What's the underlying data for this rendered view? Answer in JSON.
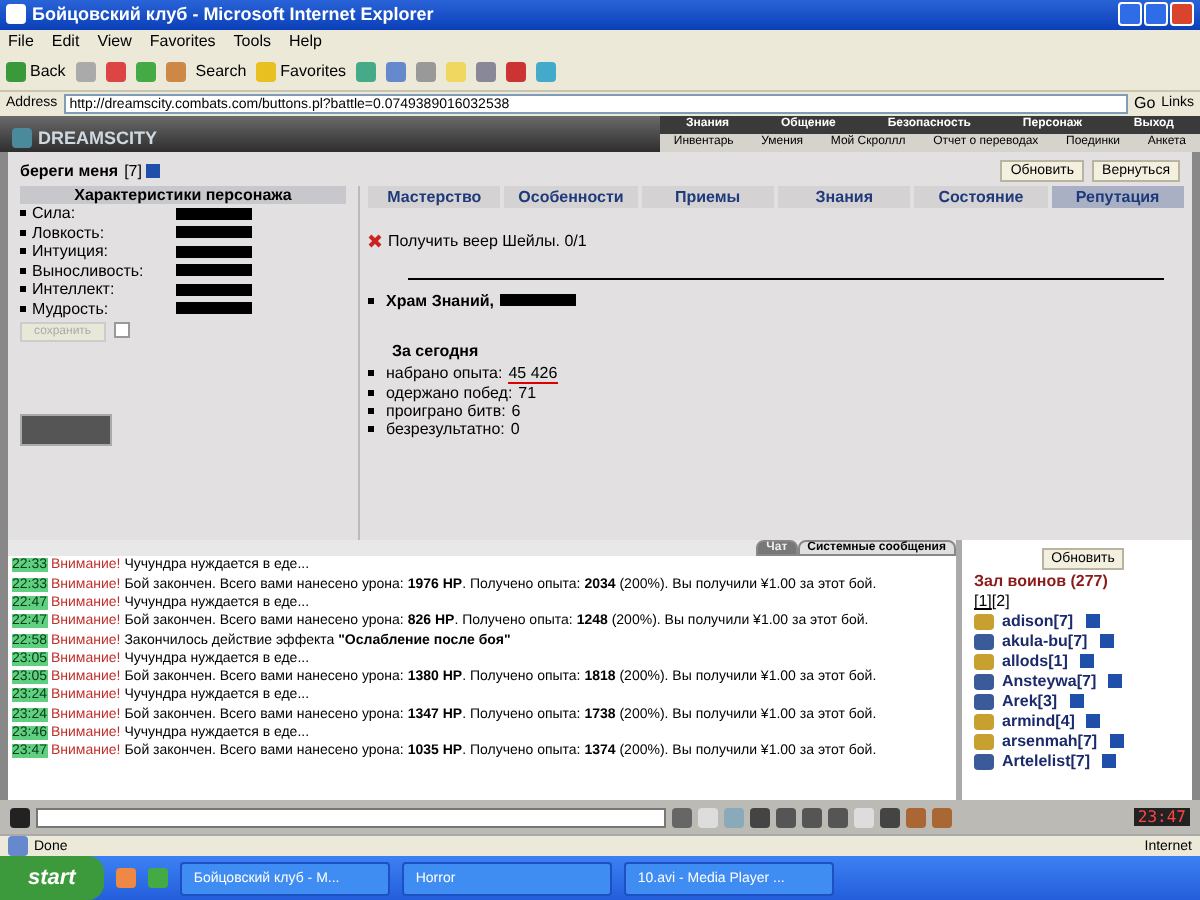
{
  "window": {
    "title": "Бойцовский клуб - Microsoft Internet Explorer"
  },
  "menu": [
    "File",
    "Edit",
    "View",
    "Favorites",
    "Tools",
    "Help"
  ],
  "toolbar": {
    "back": "Back",
    "search": "Search",
    "favorites": "Favorites"
  },
  "address": {
    "label": "Address",
    "url": "http://dreamscity.combats.com/buttons.pl?battle=0.0749389016032538",
    "go": "Go",
    "links": "Links"
  },
  "game_header": {
    "logo": "DREAMSCITY",
    "nav": [
      "Знания",
      "Общение",
      "Безопасность",
      "Персонаж",
      "Выход"
    ],
    "subnav": [
      "Инвентарь",
      "Умения",
      "Мой Скроллл",
      "Отчет о переводах",
      "Поединки",
      "Анкета"
    ]
  },
  "character": {
    "name": "береги меня",
    "level": "[7]",
    "buttons": [
      "Обновить",
      "Вернуться"
    ]
  },
  "stats": {
    "title": "Характеристики персонажа",
    "items": [
      "Сила:",
      "Ловкость:",
      "Интуиция:",
      "Выносливость:",
      "Интеллект:",
      "Мудрость:"
    ],
    "save": {
      "label": "сохранить",
      "disabled": true
    },
    "checkbox": {
      "checked": false
    }
  },
  "tabs": [
    {
      "label": "Мастерство",
      "selected": false
    },
    {
      "label": "Особенности",
      "selected": false
    },
    {
      "label": "Приемы",
      "selected": false
    },
    {
      "label": "Знания",
      "selected": false
    },
    {
      "label": "Состояние",
      "selected": false
    },
    {
      "label": "Репутация",
      "selected": true
    }
  ],
  "reputation": {
    "quest": "Получить веер Шейлы. 0/1",
    "place": "Храм Знаний,",
    "today_title": "За сегодня",
    "today": [
      {
        "label": "набрано опыта:",
        "value": "45 426",
        "highlighted": true
      },
      {
        "label": "одержано побед:",
        "value": "71",
        "highlighted": false
      },
      {
        "label": "проиграно битв:",
        "value": "6",
        "highlighted": false
      },
      {
        "label": "безрезультатно:",
        "value": "0",
        "highlighted": false
      }
    ]
  },
  "chat": {
    "tabs": [
      {
        "label": "Чат",
        "selected": false
      },
      {
        "label": "Системные сообщения",
        "selected": true
      }
    ],
    "messages": [
      {
        "time": "22:33",
        "alert": "Внимание!",
        "text": "Чучундра нуждается в еде..."
      },
      {
        "time": "22:33",
        "alert": "Внимание!",
        "text": "Бой закончен. Всего вами нанесено урона: **1976 HP**. Получено опыта: **2034** (200%). Вы получили ¥1.00 за этот бой."
      },
      {
        "time": "22:47",
        "alert": "Внимание!",
        "text": "Чучундра нуждается в еде..."
      },
      {
        "time": "22:47",
        "alert": "Внимание!",
        "text": "Бой закончен. Всего вами нанесено урона: **826 HP**. Получено опыта: **1248** (200%). Вы получили ¥1.00 за этот бой."
      },
      {
        "time": "22:58",
        "alert": "Внимание!",
        "text": "Закончилось действие эффекта **\"Ослабление после боя\"**"
      },
      {
        "time": "23:05",
        "alert": "Внимание!",
        "text": "Чучундра нуждается в еде..."
      },
      {
        "time": "23:05",
        "alert": "Внимание!",
        "text": "Бой закончен. Всего вами нанесено урона: **1380 HP**. Получено опыта: **1818** (200%). Вы получили ¥1.00 за этот бой."
      },
      {
        "time": "23:24",
        "alert": "Внимание!",
        "text": "Чучундра нуждается в еде..."
      },
      {
        "time": "23:24",
        "alert": "Внимание!",
        "text": "Бой закончен. Всего вами нанесено урона: **1347 HP**. Получено опыта: **1738** (200%). Вы получили ¥1.00 за этот бой."
      },
      {
        "time": "23:46",
        "alert": "Внимание!",
        "text": "Чучундра нуждается в еде..."
      },
      {
        "time": "23:47",
        "alert": "Внимание!",
        "text": "Бой закончен. Всего вами нанесено урона: **1035 HP**. Получено опыта: **1374** (200%). Вы получили ¥1.00 за этот бой."
      }
    ]
  },
  "room": {
    "refresh": "Обновить",
    "title": "Зал воинов (277)",
    "pages": [
      {
        "label": "[1]",
        "selected": true
      },
      {
        "label": "[2]",
        "selected": false
      }
    ],
    "users": [
      {
        "name": "adison",
        "level": "[7]",
        "kind": "warrior"
      },
      {
        "name": "akula-bu",
        "level": "[7]",
        "kind": "mage"
      },
      {
        "name": "allods",
        "level": "[1]",
        "kind": "warrior"
      },
      {
        "name": "Ansteywa",
        "level": "[7]",
        "kind": "mage"
      },
      {
        "name": "Arek",
        "level": "[3]",
        "kind": "mage"
      },
      {
        "name": "armind",
        "level": "[4]",
        "kind": "warrior"
      },
      {
        "name": "arsenmah",
        "level": "[7]",
        "kind": "warrior"
      },
      {
        "name": "Artelelist",
        "level": "[7]",
        "kind": "mage"
      }
    ]
  },
  "clock": "23:47",
  "status_bar": {
    "text": "Done",
    "zone": "Internet"
  },
  "taskbar": {
    "start": "start",
    "windows": [
      "Бойцовский клуб - M...",
      "Horror",
      "10.avi - Media Player ..."
    ]
  }
}
